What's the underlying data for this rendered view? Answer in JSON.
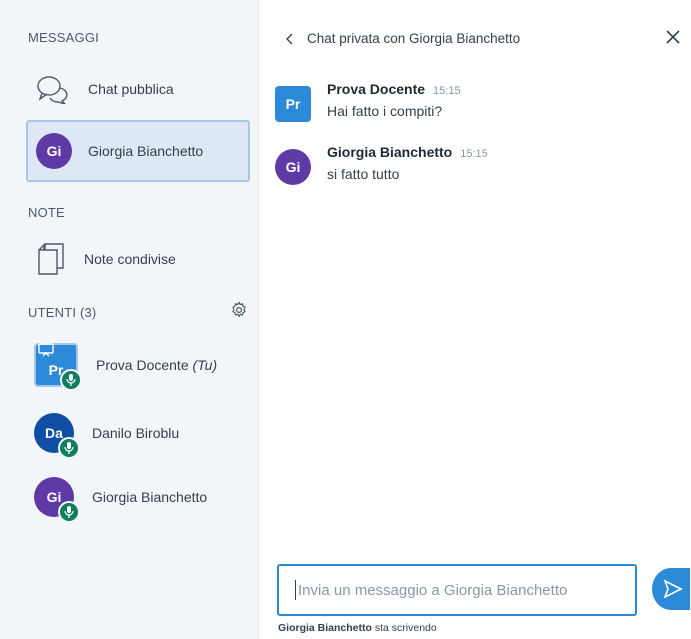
{
  "sidebar": {
    "messages_title": "MESSAGGI",
    "public_chat": {
      "label": "Chat pubblica",
      "icon": "chat-bubbles-icon"
    },
    "private_chat": {
      "initials": "Gi",
      "label": "Giorgia Bianchetto",
      "color": "#5f3aa6"
    },
    "notes_title": "NOTE",
    "shared_notes": {
      "label": "Note condivise",
      "icon": "document-icon"
    },
    "users_title": "UTENTI (3)",
    "users": [
      {
        "initials": "Pr",
        "name": "Prova Docente",
        "suffix": "(Tu)",
        "color": "#2d8ad8",
        "presenter": true
      },
      {
        "initials": "Da",
        "name": "Danilo Biroblu",
        "color": "#0e4fa3"
      },
      {
        "initials": "Gi",
        "name": "Giorgia Bianchetto",
        "color": "#5f3aa6"
      }
    ]
  },
  "chat": {
    "header": "Chat privata con Giorgia Bianchetto",
    "messages": [
      {
        "initials": "Pr",
        "name": "Prova Docente",
        "time": "15:15",
        "text": "Hai fatto i compiti?",
        "color": "#2d8ad8"
      },
      {
        "initials": "Gi",
        "name": "Giorgia Bianchetto",
        "time": "15:15",
        "text": "si fatto tutto",
        "color": "#5f3aa6"
      }
    ],
    "input_placeholder": "Invia un messaggio a Giorgia Bianchetto",
    "typing_name": "Giorgia Bianchetto",
    "typing_suffix": " sta scrivendo"
  }
}
